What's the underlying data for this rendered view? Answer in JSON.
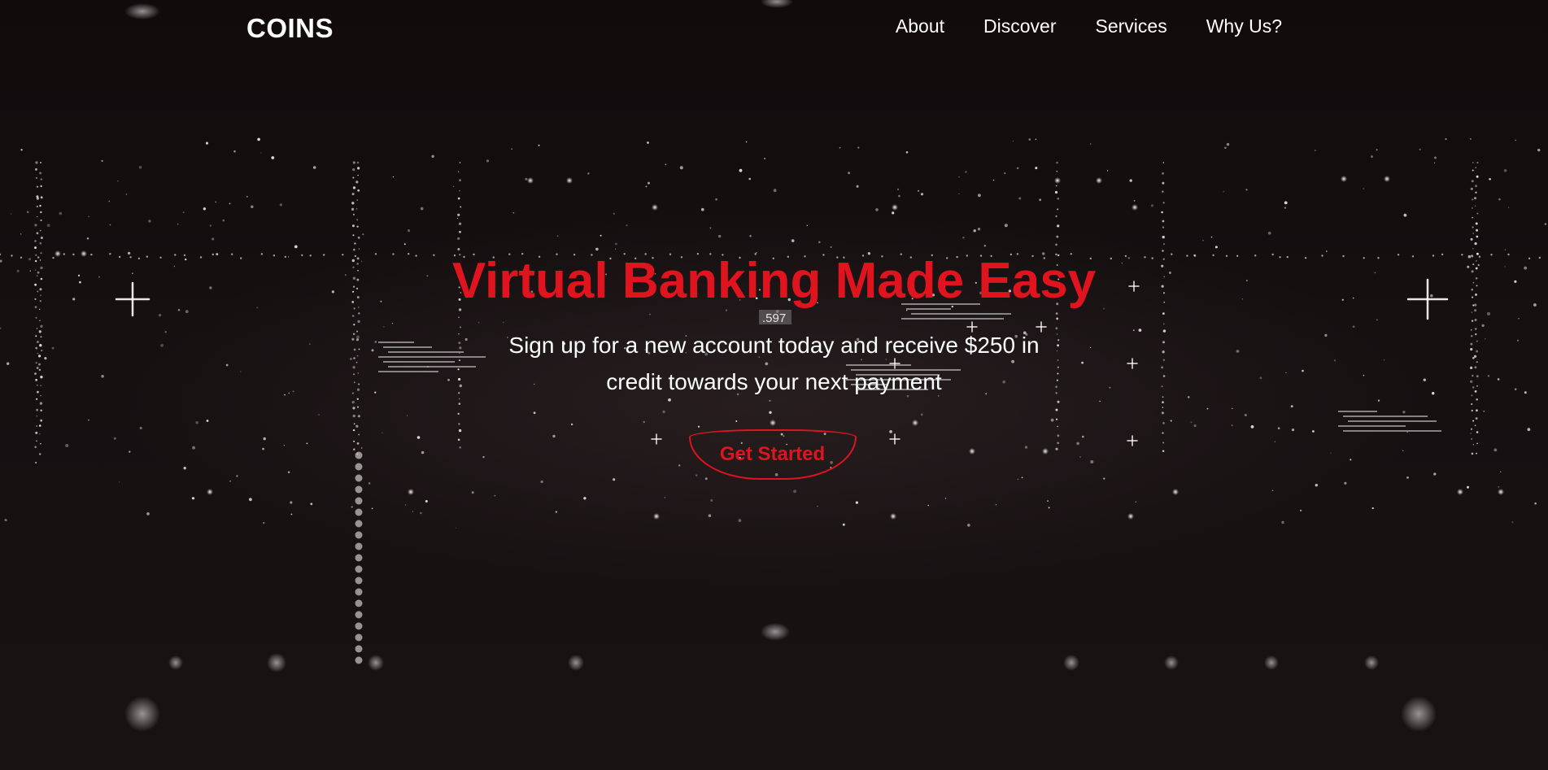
{
  "navbar": {
    "logo": "COINS",
    "links": [
      {
        "label": "About"
      },
      {
        "label": "Discover"
      },
      {
        "label": "Services"
      },
      {
        "label": "Why Us?"
      }
    ]
  },
  "hero": {
    "title": "Virtual Banking Made Easy",
    "subtitle": "Sign up for a new account today and receive $250 in credit towards your next payment",
    "cta_label": "Get Started",
    "background_number": ".597"
  },
  "colors": {
    "accent": "#e0141e",
    "background": "#140d0e",
    "text": "#ffffff"
  }
}
